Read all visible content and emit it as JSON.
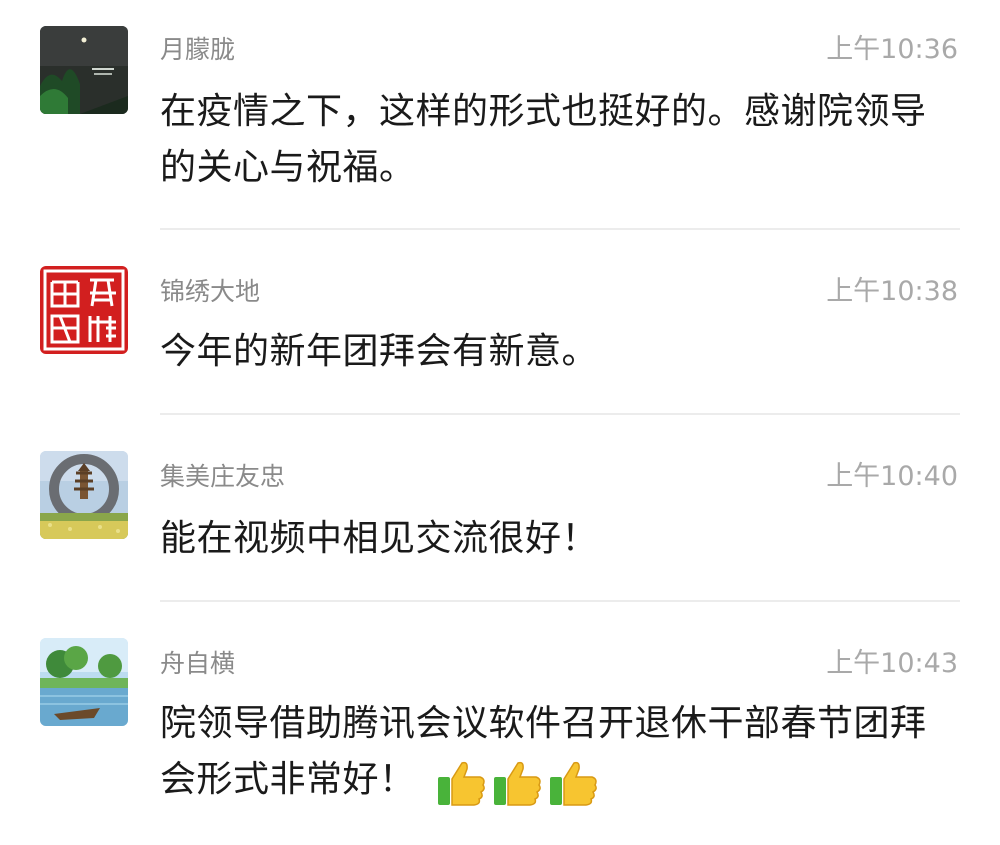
{
  "comments": [
    {
      "name": "月朦胧",
      "time": "上午10:36",
      "text": "在疫情之下，这样的形式也挺好的。感谢院领导的关心与祝福。",
      "avatar_icon": "moonlit-night-avatar"
    },
    {
      "name": "锦绣大地",
      "time": "上午10:38",
      "text": "今年的新年团拜会有新意。",
      "avatar_icon": "red-seal-stamp-avatar",
      "avatar_color": "#d21f1f"
    },
    {
      "name": "集美庄友忠",
      "time": "上午10:40",
      "text": "能在视频中相见交流很好！",
      "avatar_icon": "pagoda-moon-gate-avatar"
    },
    {
      "name": "舟自横",
      "time": "上午10:43",
      "text": "院领导借助腾讯会议软件召开退休干部春节团拜会形式非常好！",
      "avatar_icon": "boat-on-river-avatar",
      "emoji": [
        "thumbs-up-icon",
        "thumbs-up-icon",
        "thumbs-up-icon"
      ]
    }
  ],
  "colors": {
    "name": "#8a8a8a",
    "time": "#a9a9a9",
    "text": "#1a1a1a",
    "divider": "#ececec"
  }
}
